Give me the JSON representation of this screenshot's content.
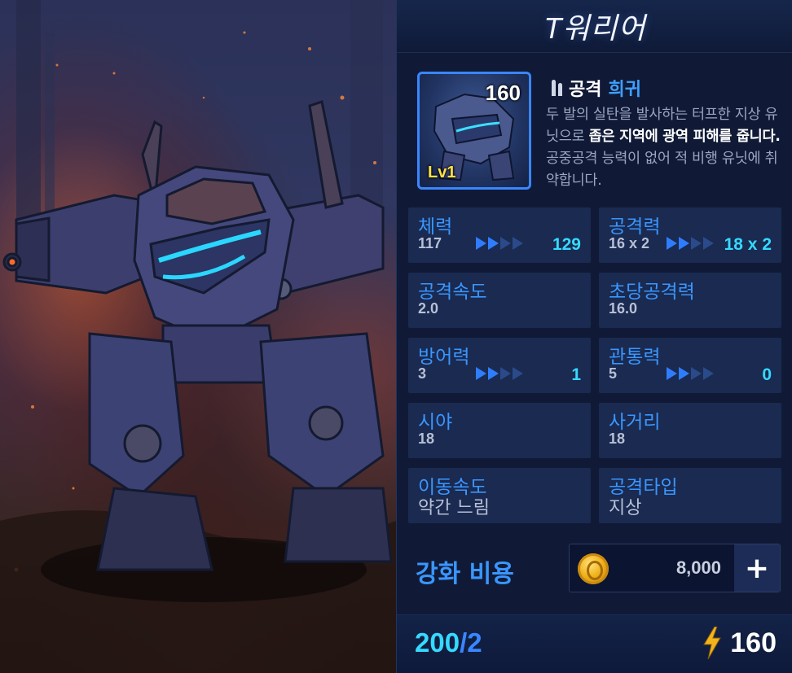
{
  "title": "T워리어",
  "unit": {
    "cost": "160",
    "level": "Lv1",
    "type_label": "공격",
    "rarity": "희귀",
    "desc_1": "두 발의 실탄을 발사하는 터프한 지상 유닛으로 ",
    "desc_hl": "좁은 지역에 광역 피해를 줍니다.",
    "desc_2": " 공중공격 능력이 없어 적 비행 유닛에 취약합니다."
  },
  "stats": [
    {
      "label": "체력",
      "value": "117",
      "next": "129",
      "arrows": 4
    },
    {
      "label": "공격력",
      "value": "16 x 2",
      "next": "18 x 2",
      "arrows": 4
    },
    {
      "label": "공격속도",
      "value": "2.0"
    },
    {
      "label": "초당공격력",
      "value": "16.0"
    },
    {
      "label": "방어력",
      "value": "3",
      "next": "1",
      "arrows": 4
    },
    {
      "label": "관통력",
      "value": "5",
      "next": "0",
      "arrows": 4
    },
    {
      "label": "시야",
      "value": "18"
    },
    {
      "label": "사거리",
      "value": "18"
    },
    {
      "label": "이동속도",
      "value": "약간 느림"
    },
    {
      "label": "공격타입",
      "value": "지상"
    }
  ],
  "upgrade": {
    "label": "강화 비용",
    "cost": "8,000",
    "plus": "+"
  },
  "footer": {
    "supply_current": "200",
    "supply_sep": "/",
    "supply_max": "2",
    "energy": "160"
  },
  "icons": {
    "ammo": "ammo-icon",
    "coin": "coin-icon",
    "energy": "lightning-icon",
    "arrow": "arrow-right-icon"
  },
  "colors": {
    "accent_blue": "#3a96ff",
    "highlight_cyan": "#36d9ff",
    "panel_bg": "#101a36",
    "box_bg": "#1a2a50",
    "level_yellow": "#ffe04a"
  }
}
